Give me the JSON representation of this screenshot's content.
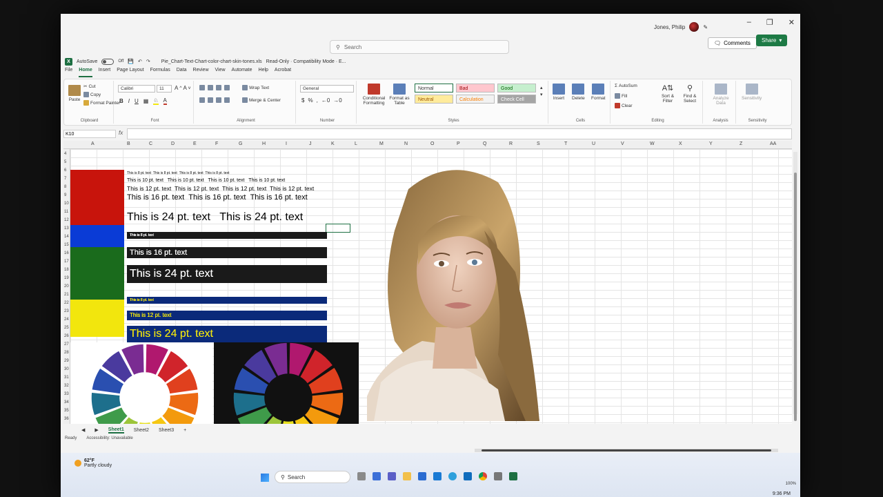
{
  "title_bar": {
    "autosave_label": "AutoSave",
    "autosave_state": "Off",
    "filename": "Pie_Chart-Text-Chart-color-chart-skin-tones.xls",
    "mode": "Read-Only · Compatibility Mode · E...",
    "search_placeholder": "Search",
    "user_name": "Jones, Philip",
    "comments_label": "Comments",
    "share_label": "Share"
  },
  "menu": [
    "File",
    "Home",
    "Insert",
    "Page Layout",
    "Formulas",
    "Data",
    "Review",
    "View",
    "Automate",
    "Help",
    "Acrobat"
  ],
  "ribbon": {
    "clipboard": {
      "paste": "Paste",
      "cut": "Cut",
      "copy": "Copy",
      "format_painter": "Format Painter",
      "label": "Clipboard"
    },
    "font": {
      "name": "Calibri",
      "size": "11",
      "label": "Font"
    },
    "alignment": {
      "wrap": "Wrap Text",
      "merge": "Merge & Center",
      "label": "Alignment"
    },
    "number": {
      "format": "General",
      "label": "Number"
    },
    "styles": {
      "conditional": "Conditional Formatting",
      "format_table": "Format as Table",
      "normal": "Normal",
      "bad": "Bad",
      "good": "Good",
      "neutral": "Neutral",
      "calculation": "Calculation",
      "check_cell": "Check Cell",
      "label": "Styles"
    },
    "cells": {
      "insert": "Insert",
      "delete": "Delete",
      "format": "Format",
      "label": "Cells"
    },
    "editing": {
      "autosum": "AutoSum",
      "fill": "Fill",
      "clear": "Clear",
      "sort": "Sort & Filter",
      "find": "Find & Select",
      "label": "Editing"
    },
    "analysis": {
      "analyze": "Analyze Data",
      "label": "Analysis"
    },
    "sensitivity": {
      "button": "Sensitivity",
      "label": "Sensitivity"
    }
  },
  "name_box": "K10",
  "columns": [
    "A",
    "B",
    "C",
    "D",
    "E",
    "F",
    "G",
    "H",
    "I",
    "J",
    "K",
    "L",
    "M",
    "N",
    "O",
    "P",
    "Q",
    "R",
    "S",
    "T",
    "U",
    "V",
    "W",
    "X",
    "Y",
    "Z",
    "AA"
  ],
  "rows": [
    "4",
    "5",
    "6",
    "7",
    "8",
    "9",
    "10",
    "11",
    "12",
    "13",
    "14",
    "15",
    "16",
    "17",
    "18",
    "19",
    "20",
    "21",
    "22",
    "23",
    "24",
    "25",
    "26",
    "27",
    "28",
    "29",
    "30",
    "31",
    "32",
    "33",
    "34",
    "35",
    "36"
  ],
  "sheet_text": {
    "t8": "This is 8 pt. text",
    "t10": "This is 10 pt. text",
    "t12": "This is 12 pt. text",
    "t16": "This is 16 pt. text",
    "t24": "This is 24 pt. text"
  },
  "colors": {
    "red": "#c8140c",
    "blue": "#0a3bd6",
    "green": "#1a6b1c",
    "yellow": "#f2e60d",
    "black_band": "#1a1a1a",
    "navy_band": "#0b2a7a",
    "excel_green": "#1d6f42"
  },
  "sheet_tabs": [
    "Sheet1",
    "Sheet2",
    "Sheet3"
  ],
  "status": {
    "ready": "Ready",
    "accessibility": "Accessibility: Unavailable",
    "zoom": "100%"
  },
  "taskbar": {
    "temperature": "62°F",
    "weather": "Partly cloudy",
    "search": "Search",
    "time": "9:36 PM"
  }
}
